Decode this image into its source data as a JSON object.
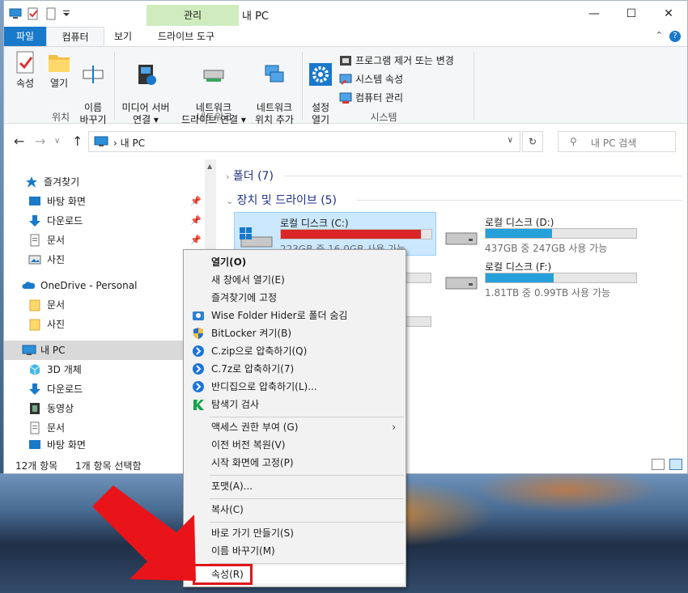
{
  "window": {
    "title": "내 PC",
    "context_tab": "관리"
  },
  "tabs": [
    "파일",
    "컴퓨터",
    "보기",
    "드라이브 도구"
  ],
  "ribbon": {
    "location_group": {
      "label": "위치",
      "buttons": [
        "속성",
        "열기",
        "이름\n바꾸기"
      ]
    },
    "network_group": {
      "label": "네트워크",
      "buttons": [
        "미디어 서버\n연결 ▾",
        "네트워크\n드라이브 연결 ▾",
        "네트워크\n위치 추가"
      ]
    },
    "system_group": {
      "label": "시스템",
      "big_button": "설정\n열기",
      "small_buttons": [
        "프로그램 제거 또는 변경",
        "시스템 속성",
        "컴퓨터 관리"
      ]
    }
  },
  "address": {
    "crumb": "내 PC",
    "search_placeholder": "내 PC 검색"
  },
  "nav": {
    "quick_access": "즐겨찾기",
    "quick_items": [
      "바탕 화면",
      "다운로드",
      "문서",
      "사진"
    ],
    "onedrive": "OneDrive - Personal",
    "onedrive_items": [
      "문서",
      "사진"
    ],
    "this_pc": "내 PC",
    "pc_items": [
      "3D 개체",
      "다운로드",
      "동영상",
      "문서",
      "바탕 화면"
    ]
  },
  "content": {
    "folders_section": "폴더",
    "folders_count": "(7)",
    "drives_section": "장치 및 드라이브",
    "drives_count": "(5)",
    "drives": [
      {
        "name": "로컬 디스크 (C:)",
        "size": "223GB 중 16.0GB 사용 가능",
        "used_fraction": 0.93,
        "selected": true,
        "color": "#da2626"
      },
      {
        "name": "로컬 디스크 (D:)",
        "size": "437GB 중 247GB 사용 가능",
        "used_fraction": 0.44,
        "selected": false,
        "color": "#26a0da"
      },
      {
        "name": "로컬 디스크 (F:)",
        "size": "1.81TB 중 0.99TB 사용 가능",
        "used_fraction": 0.45,
        "selected": false,
        "color": "#26a0da"
      }
    ]
  },
  "status": {
    "items": "12개 항목",
    "selected": "1개 항목 선택함"
  },
  "context_menu": {
    "items": [
      {
        "label": "열기(O)",
        "bold": true,
        "icon": ""
      },
      {
        "label": "새 창에서 열기(E)",
        "icon": ""
      },
      {
        "label": "즐겨찾기에 고정",
        "icon": ""
      },
      {
        "label": "Wise Folder Hider로 폴더 숨김",
        "icon": "wise-folder-hider-icon"
      },
      {
        "label": "BitLocker 켜기(B)",
        "icon": "shield-icon"
      },
      {
        "label": "C.zip으로 압축하기(Q)",
        "icon": "bandizip-icon"
      },
      {
        "label": "C.7z로 압축하기(7)",
        "icon": "bandizip-icon"
      },
      {
        "label": "반디집으로 압축하기(L)...",
        "icon": "bandizip-icon"
      },
      {
        "label": "탐색기 검사",
        "icon": "kaspersky-icon"
      },
      {
        "label": "액세스 권한 부여 (G)",
        "submenu": true
      },
      {
        "label": "이전 버전 복원(V)"
      },
      {
        "label": "시작 화면에 고정(P)"
      },
      {
        "label": "포맷(A)..."
      },
      {
        "label": "복사(C)"
      },
      {
        "label": "바로 가기 만들기(S)"
      },
      {
        "label": "이름 바꾸기(M)"
      },
      {
        "label": "속성(R)"
      }
    ]
  },
  "accent": {
    "highlight": "#e2141a",
    "arrow": "#e8141a"
  }
}
